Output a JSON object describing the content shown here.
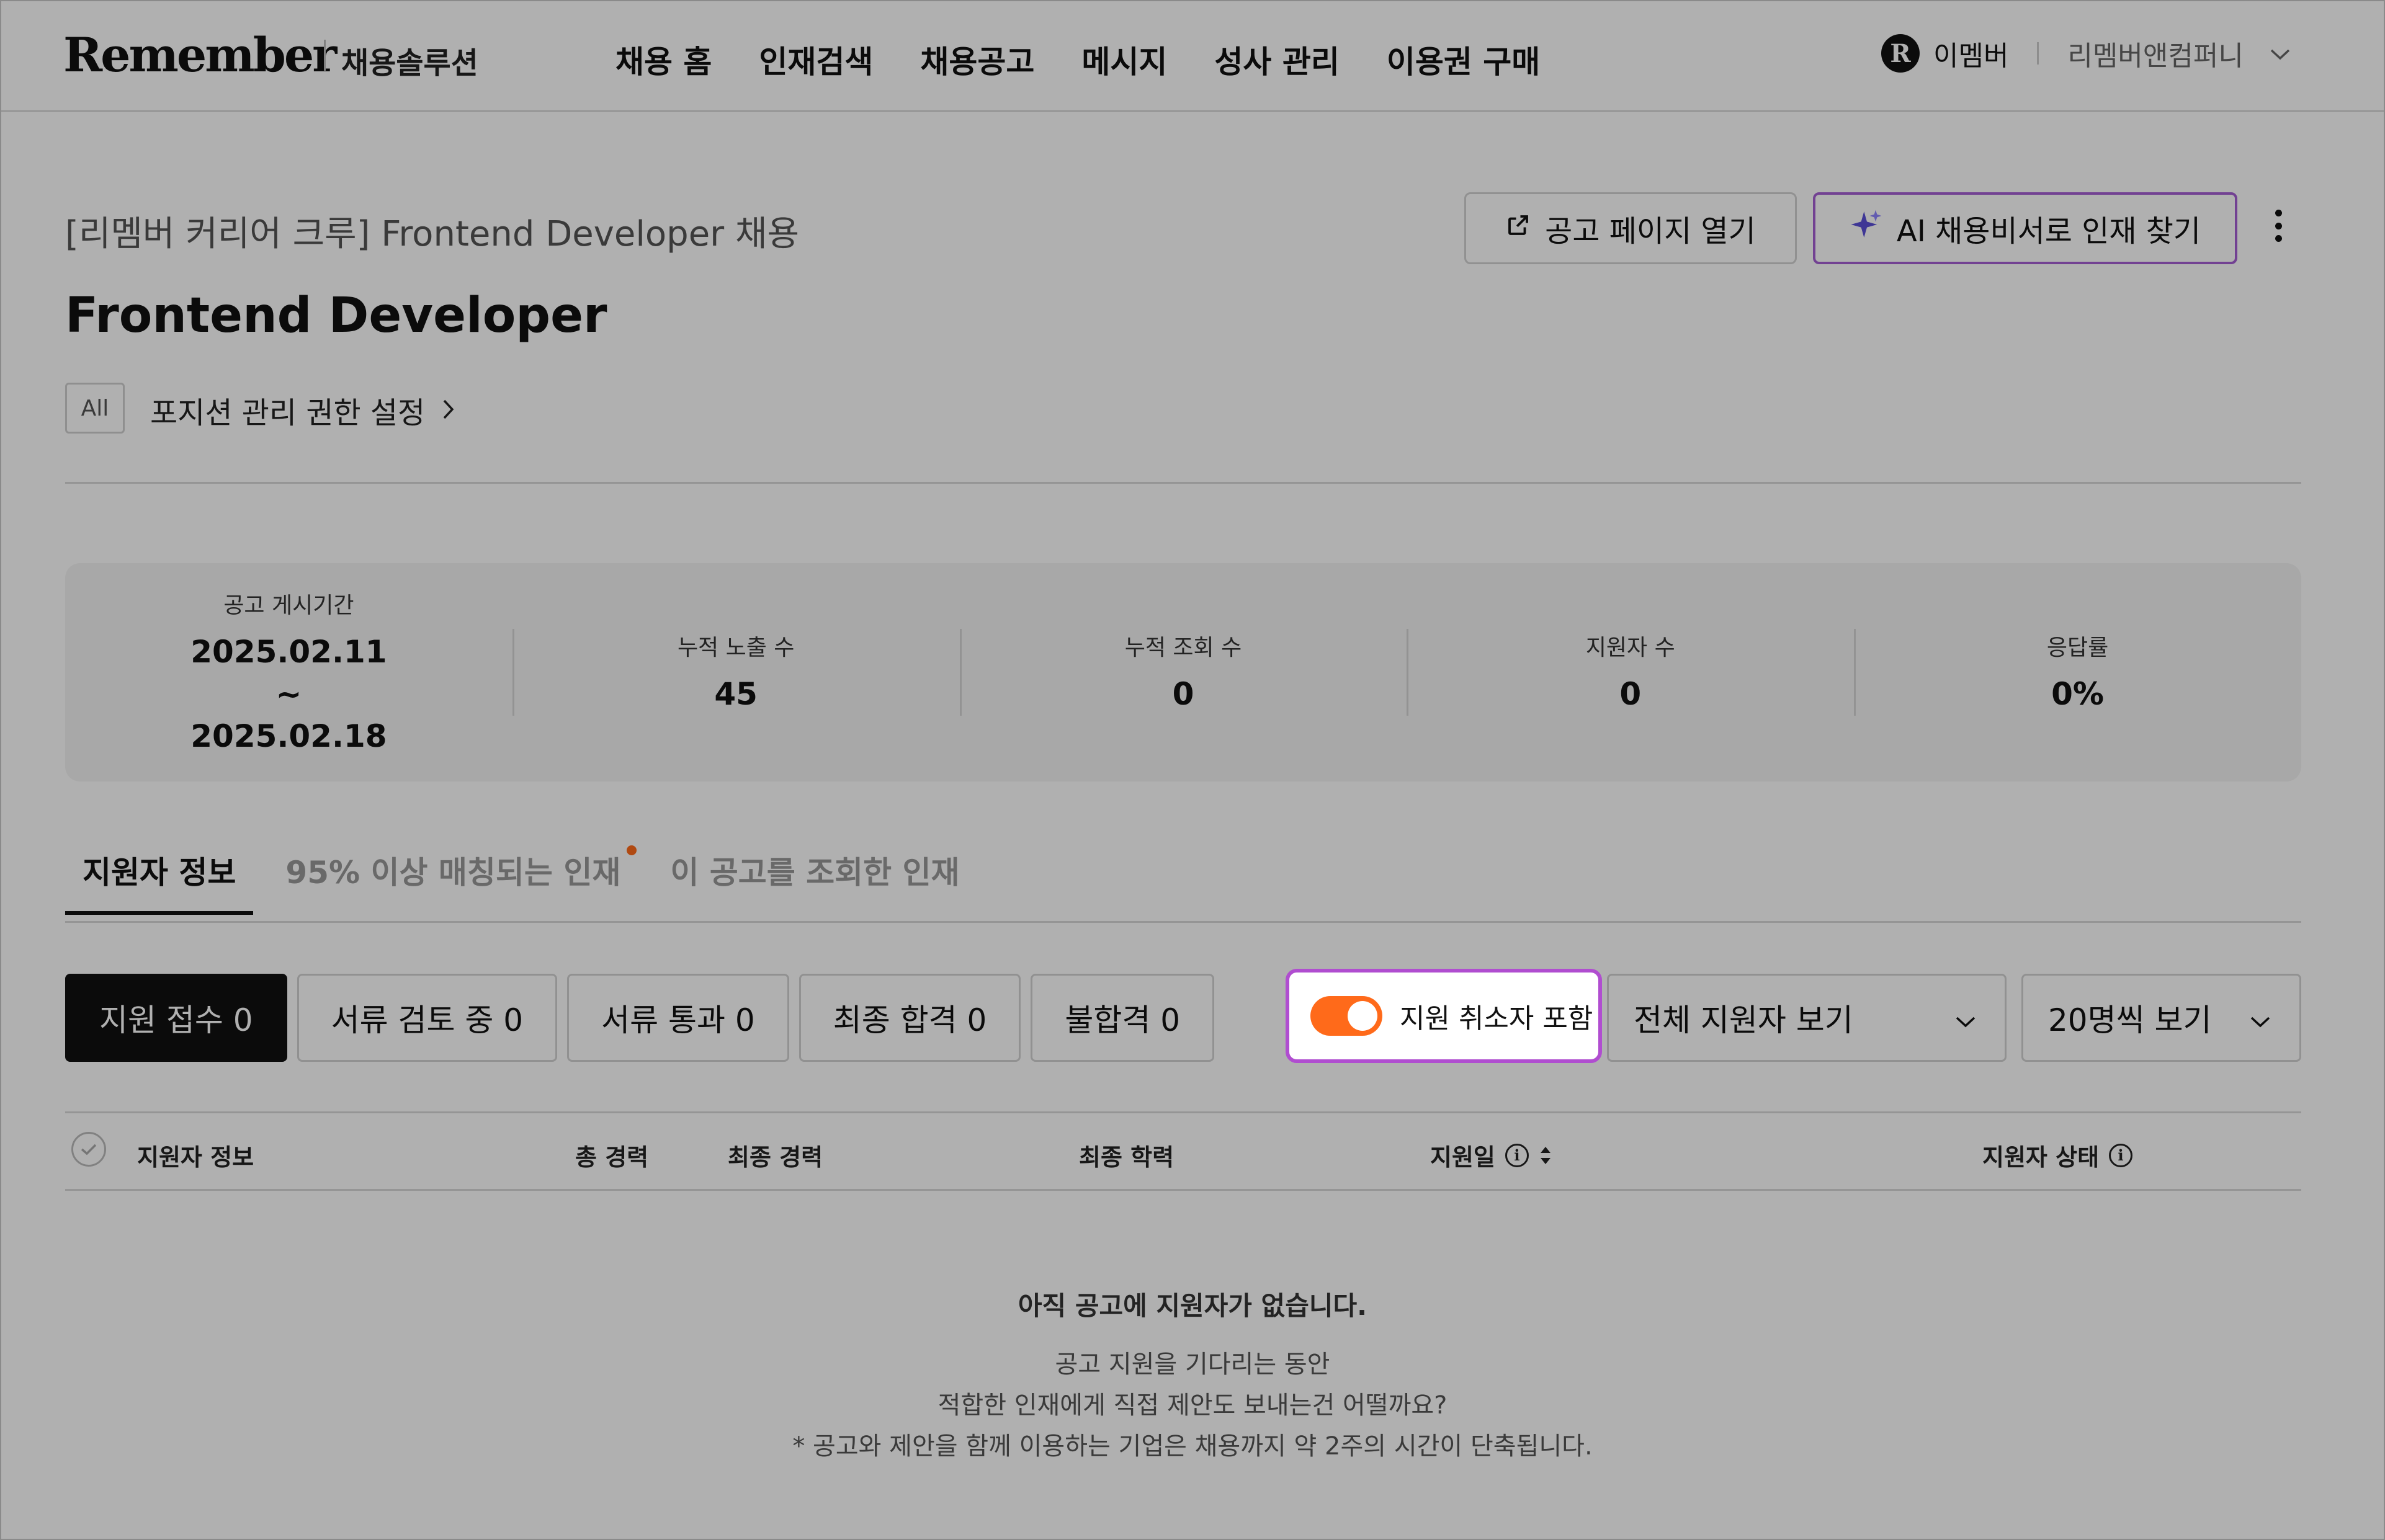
{
  "header": {
    "logo": "Remember",
    "solution_label": "채용솔루션",
    "nav": [
      "채용 홈",
      "인재검색",
      "채용공고",
      "메시지",
      "성사 관리",
      "이용권 구매"
    ],
    "user_icon_letter": "R",
    "user_name": "이멤버",
    "company": "리멤버앤컴퍼니"
  },
  "job": {
    "subtitle": "[리멤버 커리어 크루] Frontend Developer 채용",
    "title": "Frontend Developer",
    "badge": "All",
    "permission_link": "포지션 관리 권한 설정",
    "open_page_label": "공고 페이지 열기",
    "ai_label": "AI 채용비서로 인재 찾기"
  },
  "stats": [
    {
      "label": "공고 게시기간",
      "value": "2025.02.11 ~ 2025.02.18"
    },
    {
      "label": "누적 노출 수",
      "value": "45"
    },
    {
      "label": "누적 조회 수",
      "value": "0"
    },
    {
      "label": "지원자 수",
      "value": "0"
    },
    {
      "label": "응답률",
      "value": "0%"
    }
  ],
  "tabs": [
    {
      "label": "지원자 정보",
      "active": true
    },
    {
      "label": "95% 이상 매칭되는 인재",
      "dot": true
    },
    {
      "label": "이 공고를 조회한 인재"
    }
  ],
  "filters": [
    "지원 접수 0",
    "서류 검토 중 0",
    "서류 통과 0",
    "최종 합격 0",
    "불합격 0"
  ],
  "toggle": {
    "label": "지원 취소자 포함",
    "on": true
  },
  "selects": {
    "all": "전체 지원자 보기",
    "per_page": "20명씩 보기"
  },
  "table_headers": {
    "applicant": "지원자 정보",
    "total_career": "총 경력",
    "last_career": "최종 경력",
    "education": "최종 학력",
    "applied_date": "지원일",
    "status": "지원자 상태"
  },
  "empty": {
    "title": "아직 공고에 지원자가 없습니다.",
    "line1": "공고 지원을 기다리는 동안",
    "line2": "적합한 인재에게 직접 제안도 보내는건 어떨까요?",
    "line3": "* 공고와 제안을 함께 이용하는 기업은 채용까지 약 2주의 시간이 단축됩니다."
  },
  "colors": {
    "accent": "#ff6a1a",
    "highlight": "#b04dd0",
    "ai_star": "#5b4fd8"
  }
}
